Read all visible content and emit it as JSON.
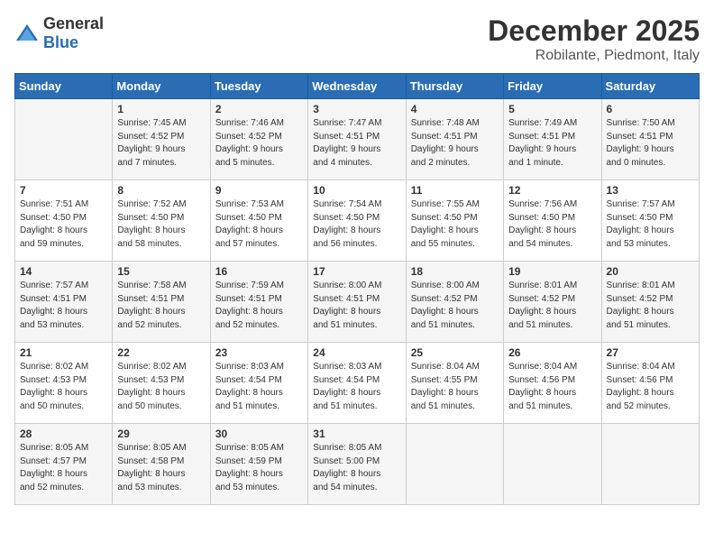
{
  "header": {
    "logo": {
      "general": "General",
      "blue": "Blue"
    },
    "title": "December 2025",
    "location": "Robilante, Piedmont, Italy"
  },
  "calendar": {
    "days_of_week": [
      "Sunday",
      "Monday",
      "Tuesday",
      "Wednesday",
      "Thursday",
      "Friday",
      "Saturday"
    ],
    "weeks": [
      [
        {
          "day": "",
          "info": ""
        },
        {
          "day": "1",
          "info": "Sunrise: 7:45 AM\nSunset: 4:52 PM\nDaylight: 9 hours\nand 7 minutes."
        },
        {
          "day": "2",
          "info": "Sunrise: 7:46 AM\nSunset: 4:52 PM\nDaylight: 9 hours\nand 5 minutes."
        },
        {
          "day": "3",
          "info": "Sunrise: 7:47 AM\nSunset: 4:51 PM\nDaylight: 9 hours\nand 4 minutes."
        },
        {
          "day": "4",
          "info": "Sunrise: 7:48 AM\nSunset: 4:51 PM\nDaylight: 9 hours\nand 2 minutes."
        },
        {
          "day": "5",
          "info": "Sunrise: 7:49 AM\nSunset: 4:51 PM\nDaylight: 9 hours\nand 1 minute."
        },
        {
          "day": "6",
          "info": "Sunrise: 7:50 AM\nSunset: 4:51 PM\nDaylight: 9 hours\nand 0 minutes."
        }
      ],
      [
        {
          "day": "7",
          "info": "Sunrise: 7:51 AM\nSunset: 4:50 PM\nDaylight: 8 hours\nand 59 minutes."
        },
        {
          "day": "8",
          "info": "Sunrise: 7:52 AM\nSunset: 4:50 PM\nDaylight: 8 hours\nand 58 minutes."
        },
        {
          "day": "9",
          "info": "Sunrise: 7:53 AM\nSunset: 4:50 PM\nDaylight: 8 hours\nand 57 minutes."
        },
        {
          "day": "10",
          "info": "Sunrise: 7:54 AM\nSunset: 4:50 PM\nDaylight: 8 hours\nand 56 minutes."
        },
        {
          "day": "11",
          "info": "Sunrise: 7:55 AM\nSunset: 4:50 PM\nDaylight: 8 hours\nand 55 minutes."
        },
        {
          "day": "12",
          "info": "Sunrise: 7:56 AM\nSunset: 4:50 PM\nDaylight: 8 hours\nand 54 minutes."
        },
        {
          "day": "13",
          "info": "Sunrise: 7:57 AM\nSunset: 4:50 PM\nDaylight: 8 hours\nand 53 minutes."
        }
      ],
      [
        {
          "day": "14",
          "info": "Sunrise: 7:57 AM\nSunset: 4:51 PM\nDaylight: 8 hours\nand 53 minutes."
        },
        {
          "day": "15",
          "info": "Sunrise: 7:58 AM\nSunset: 4:51 PM\nDaylight: 8 hours\nand 52 minutes."
        },
        {
          "day": "16",
          "info": "Sunrise: 7:59 AM\nSunset: 4:51 PM\nDaylight: 8 hours\nand 52 minutes."
        },
        {
          "day": "17",
          "info": "Sunrise: 8:00 AM\nSunset: 4:51 PM\nDaylight: 8 hours\nand 51 minutes."
        },
        {
          "day": "18",
          "info": "Sunrise: 8:00 AM\nSunset: 4:52 PM\nDaylight: 8 hours\nand 51 minutes."
        },
        {
          "day": "19",
          "info": "Sunrise: 8:01 AM\nSunset: 4:52 PM\nDaylight: 8 hours\nand 51 minutes."
        },
        {
          "day": "20",
          "info": "Sunrise: 8:01 AM\nSunset: 4:52 PM\nDaylight: 8 hours\nand 51 minutes."
        }
      ],
      [
        {
          "day": "21",
          "info": "Sunrise: 8:02 AM\nSunset: 4:53 PM\nDaylight: 8 hours\nand 50 minutes."
        },
        {
          "day": "22",
          "info": "Sunrise: 8:02 AM\nSunset: 4:53 PM\nDaylight: 8 hours\nand 50 minutes."
        },
        {
          "day": "23",
          "info": "Sunrise: 8:03 AM\nSunset: 4:54 PM\nDaylight: 8 hours\nand 51 minutes."
        },
        {
          "day": "24",
          "info": "Sunrise: 8:03 AM\nSunset: 4:54 PM\nDaylight: 8 hours\nand 51 minutes."
        },
        {
          "day": "25",
          "info": "Sunrise: 8:04 AM\nSunset: 4:55 PM\nDaylight: 8 hours\nand 51 minutes."
        },
        {
          "day": "26",
          "info": "Sunrise: 8:04 AM\nSunset: 4:56 PM\nDaylight: 8 hours\nand 51 minutes."
        },
        {
          "day": "27",
          "info": "Sunrise: 8:04 AM\nSunset: 4:56 PM\nDaylight: 8 hours\nand 52 minutes."
        }
      ],
      [
        {
          "day": "28",
          "info": "Sunrise: 8:05 AM\nSunset: 4:57 PM\nDaylight: 8 hours\nand 52 minutes."
        },
        {
          "day": "29",
          "info": "Sunrise: 8:05 AM\nSunset: 4:58 PM\nDaylight: 8 hours\nand 53 minutes."
        },
        {
          "day": "30",
          "info": "Sunrise: 8:05 AM\nSunset: 4:59 PM\nDaylight: 8 hours\nand 53 minutes."
        },
        {
          "day": "31",
          "info": "Sunrise: 8:05 AM\nSunset: 5:00 PM\nDaylight: 8 hours\nand 54 minutes."
        },
        {
          "day": "",
          "info": ""
        },
        {
          "day": "",
          "info": ""
        },
        {
          "day": "",
          "info": ""
        }
      ]
    ]
  }
}
